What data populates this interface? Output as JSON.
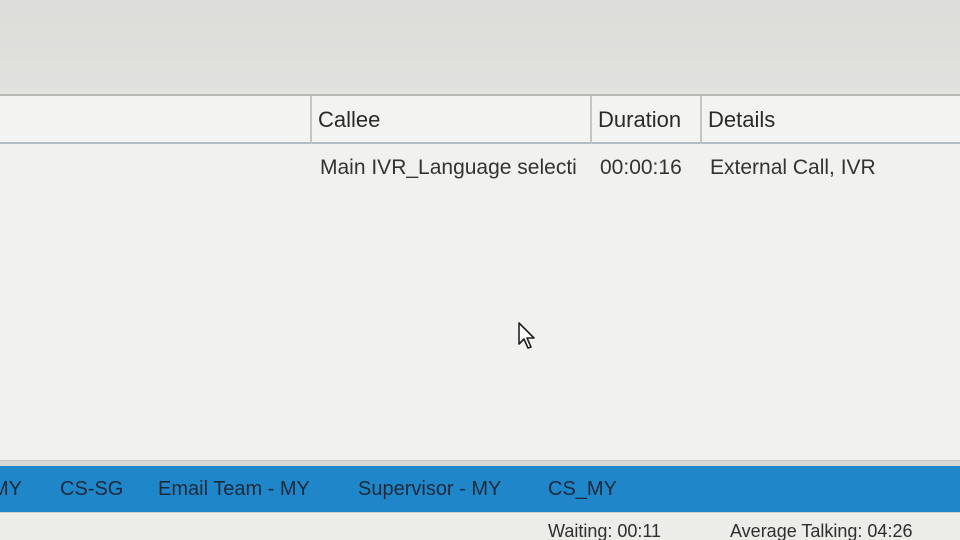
{
  "grid": {
    "columns": {
      "callee": "Callee",
      "duration": "Duration",
      "details": "Details"
    },
    "rows": [
      {
        "callee": "Main IVR_Language selecti",
        "duration": "00:00:16",
        "details": "External Call, IVR"
      }
    ]
  },
  "teams": {
    "tabs": [
      "MY",
      "CS-SG",
      "Email Team - MY",
      "Supervisor - MY",
      "CS_MY"
    ]
  },
  "status": {
    "waiting": "Waiting: 00:11",
    "average_talking": "Average Talking: 04:26"
  },
  "colors": {
    "team_bar": "#1f86c9",
    "header_border": "#b3bcc4"
  },
  "icons": {
    "cursor": "mouse-pointer-icon"
  }
}
